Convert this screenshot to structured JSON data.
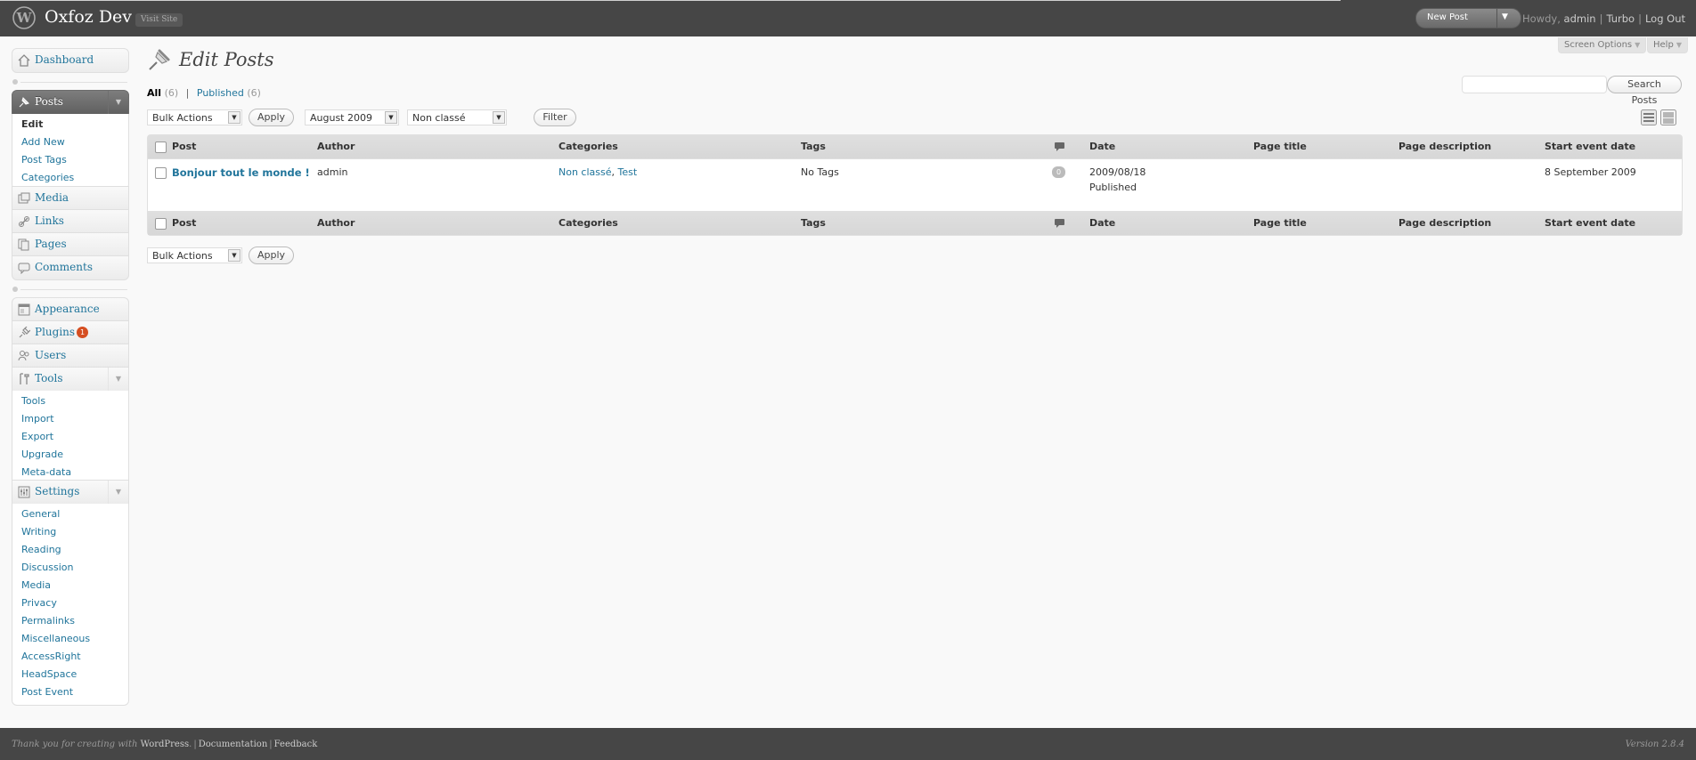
{
  "header": {
    "site_title": "Oxfoz Dev",
    "visit_site": "Visit Site",
    "favorite_action": "New Post",
    "howdy": "Howdy,",
    "user": "admin",
    "turbo": "Turbo",
    "logout": "Log Out"
  },
  "screen_meta": {
    "screen_options": "Screen Options",
    "help": "Help"
  },
  "menu": {
    "dashboard": "Dashboard",
    "posts": "Posts",
    "posts_sub": [
      "Edit",
      "Add New",
      "Post Tags",
      "Categories"
    ],
    "media": "Media",
    "links": "Links",
    "pages": "Pages",
    "comments": "Comments",
    "appearance": "Appearance",
    "plugins": "Plugins",
    "plugins_count": "1",
    "users": "Users",
    "tools": "Tools",
    "tools_sub": [
      "Tools",
      "Import",
      "Export",
      "Upgrade",
      "Meta-data"
    ],
    "settings": "Settings",
    "settings_sub": [
      "General",
      "Writing",
      "Reading",
      "Discussion",
      "Media",
      "Privacy",
      "Permalinks",
      "Miscellaneous",
      "AccessRight",
      "HeadSpace",
      "Post Event"
    ]
  },
  "page": {
    "title": "Edit Posts",
    "filters": {
      "all": "All",
      "all_count": "(6)",
      "published": "Published",
      "published_count": "(6)"
    },
    "search_value": "",
    "search_button": "Search Posts",
    "bulk_actions": "Bulk Actions",
    "apply": "Apply",
    "month": "August 2009",
    "category": "Non classé",
    "filter": "Filter"
  },
  "table": {
    "columns": [
      "Post",
      "Author",
      "Categories",
      "Tags",
      "Date",
      "Page title",
      "Page description",
      "Start event date"
    ],
    "rows": [
      {
        "title": "Bonjour tout le monde !",
        "author": "admin",
        "categories": [
          "Non classé",
          "Test"
        ],
        "category_sep": ", ",
        "tags": "No Tags",
        "comments": "0",
        "date": "2009/08/18",
        "status": "Published",
        "page_title": "",
        "page_description": "",
        "start_event_date": "8 September 2009"
      }
    ]
  },
  "footer": {
    "thanks_prefix": "Thank you for creating with",
    "wordpress": "WordPress",
    "documentation": "Documentation",
    "feedback": "Feedback",
    "version": "Version 2.8.4"
  }
}
